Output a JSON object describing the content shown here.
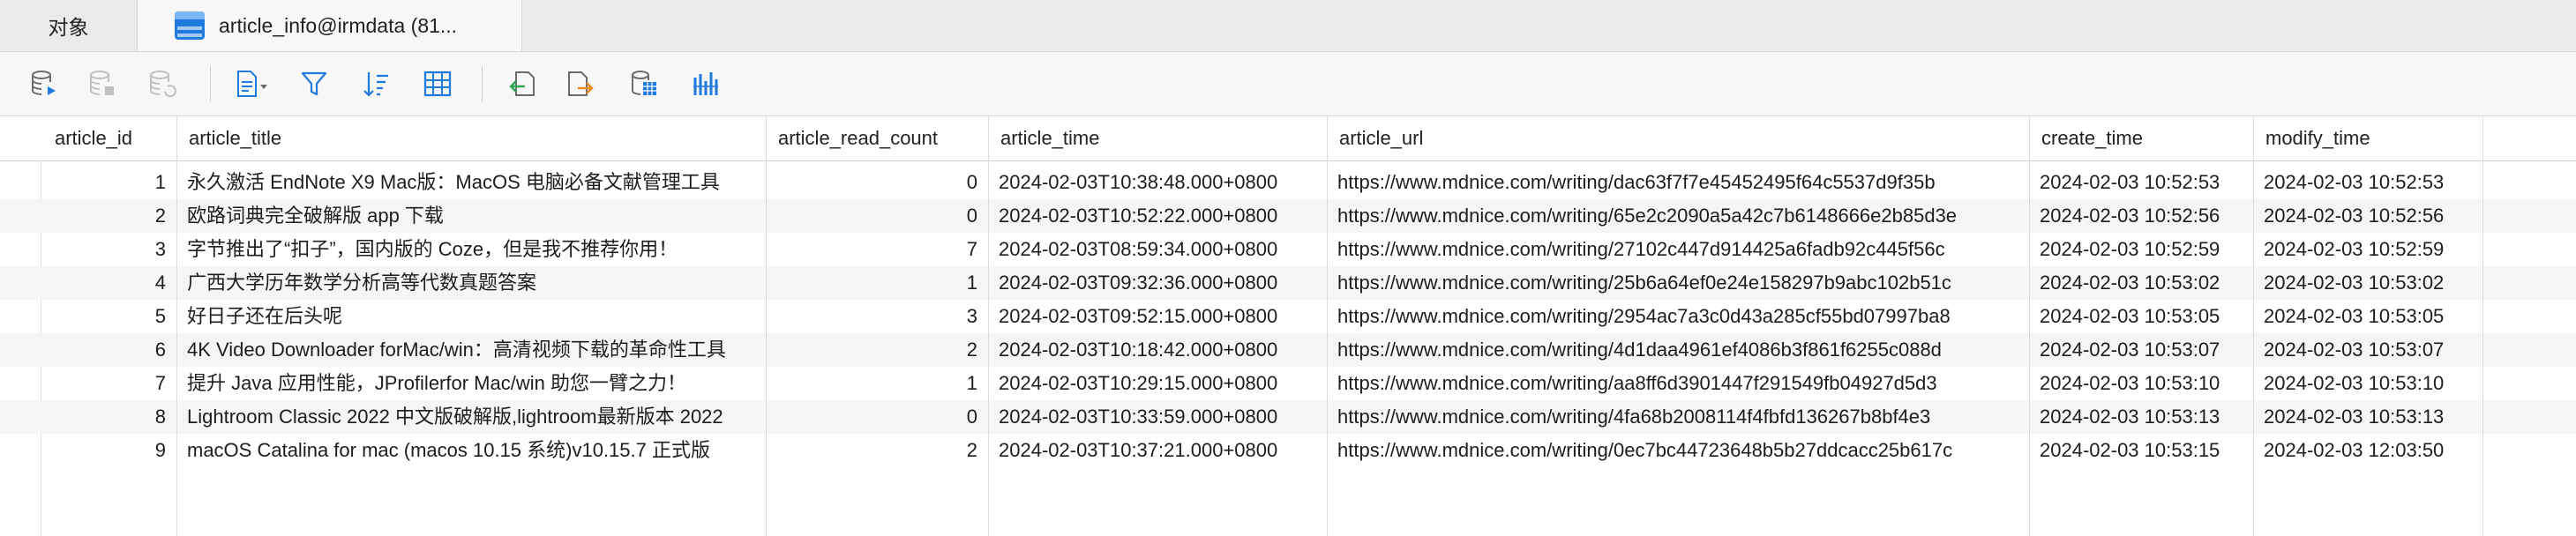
{
  "tabs": {
    "objects_label": "对象",
    "active_label": "article_info@irmdata (81..."
  },
  "toolbar": {
    "icons": [
      "table-run-icon",
      "table-stop-icon",
      "table-refresh-icon",
      "export-icon",
      "filter-icon",
      "sort-icon",
      "grid-view-icon",
      "import-wizard-icon",
      "export-wizard-icon",
      "table-design-icon",
      "chart-icon"
    ]
  },
  "accent_color": "#1f7ae0",
  "table": {
    "columns": [
      "article_id",
      "article_title",
      "article_read_count",
      "article_time",
      "article_url",
      "create_time",
      "modify_time"
    ],
    "rows": [
      [
        "1",
        "永久激活 EndNote X9 Mac版：MacOS 电脑必备文献管理工具",
        "0",
        "2024-02-03T10:38:48.000+0800",
        "https://www.mdnice.com/writing/dac63f7f7e45452495f64c5537d9f35b",
        "2024-02-03 10:52:53",
        "2024-02-03 10:52:53"
      ],
      [
        "2",
        "欧路词典完全破解版 app 下载",
        "0",
        "2024-02-03T10:52:22.000+0800",
        "https://www.mdnice.com/writing/65e2c2090a5a42c7b6148666e2b85d3e",
        "2024-02-03 10:52:56",
        "2024-02-03 10:52:56"
      ],
      [
        "3",
        "字节推出了“扣子”，国内版的 Coze，但是我不推荐你用！",
        "7",
        "2024-02-03T08:59:34.000+0800",
        "https://www.mdnice.com/writing/27102c447d914425a6fadb92c445f56c",
        "2024-02-03 10:52:59",
        "2024-02-03 10:52:59"
      ],
      [
        "4",
        "广西大学历年数学分析高等代数真题答案",
        "1",
        "2024-02-03T09:32:36.000+0800",
        "https://www.mdnice.com/writing/25b6a64ef0e24e158297b9abc102b51c",
        "2024-02-03 10:53:02",
        "2024-02-03 10:53:02"
      ],
      [
        "5",
        "好日子还在后头呢",
        "3",
        "2024-02-03T09:52:15.000+0800",
        "https://www.mdnice.com/writing/2954ac7a3c0d43a285cf55bd07997ba8",
        "2024-02-03 10:53:05",
        "2024-02-03 10:53:05"
      ],
      [
        "6",
        "4K Video Downloader forMac/win：高清视频下载的革命性工具",
        "2",
        "2024-02-03T10:18:42.000+0800",
        "https://www.mdnice.com/writing/4d1daa4961ef4086b3f861f6255c088d",
        "2024-02-03 10:53:07",
        "2024-02-03 10:53:07"
      ],
      [
        "7",
        "提升 Java 应用性能，JProfilerfor Mac/win 助您一臂之力！",
        "1",
        "2024-02-03T10:29:15.000+0800",
        "https://www.mdnice.com/writing/aa8ff6d3901447f291549fb04927d5d3",
        "2024-02-03 10:53:10",
        "2024-02-03 10:53:10"
      ],
      [
        "8",
        "Lightroom Classic 2022 中文版破解版,lightroom最新版本 2022",
        "0",
        "2024-02-03T10:33:59.000+0800",
        "https://www.mdnice.com/writing/4fa68b2008114f4fbfd136267b8bf4e3",
        "2024-02-03 10:53:13",
        "2024-02-03 10:53:13"
      ],
      [
        "9",
        "macOS Catalina for mac (macos 10.15 系统)v10.15.7 正式版",
        "2",
        "2024-02-03T10:37:21.000+0800",
        "https://www.mdnice.com/writing/0ec7bc44723648b5b27ddcacc25b617c",
        "2024-02-03 10:53:15",
        "2024-02-03 12:03:50"
      ]
    ]
  }
}
